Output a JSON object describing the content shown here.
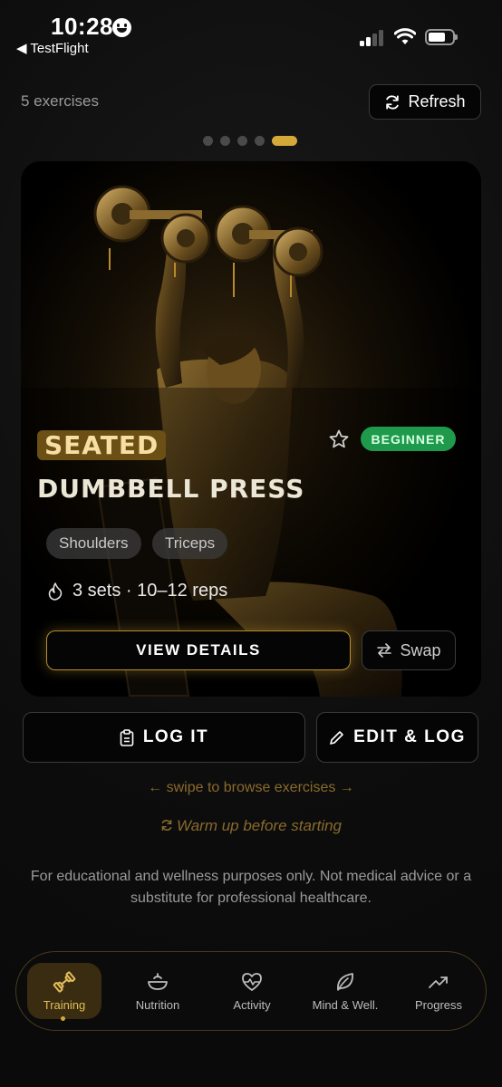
{
  "status_bar": {
    "time": "10:28",
    "back_label": "◀ TestFlight"
  },
  "header": {
    "exercise_count": "5 exercises",
    "refresh_label": "Refresh"
  },
  "pager": {
    "total": 5,
    "active_index": 4
  },
  "card": {
    "title_highlight": "SEATED",
    "title_rest": "DUMBBELL PRESS",
    "favorite_icon": "star-outline-icon",
    "level_badge": "BEGINNER",
    "muscle_tags": [
      "Shoulders",
      "Triceps"
    ],
    "prescription": "3 sets · 10–12 reps",
    "view_details_label": "VIEW DETAILS",
    "swap_label": "Swap"
  },
  "actions": {
    "log_label": "LOG IT",
    "edit_log_label": "EDIT & LOG"
  },
  "hints": {
    "swipe": "← swipe to browse exercises →",
    "warmup": "Warm up before starting"
  },
  "disclaimer": "For educational and wellness purposes only. Not medical advice or a substitute for professional healthcare.",
  "nav": {
    "items": [
      {
        "label": "Training",
        "icon": "dumbbell-icon",
        "active": true
      },
      {
        "label": "Nutrition",
        "icon": "bowl-icon",
        "active": false
      },
      {
        "label": "Activity",
        "icon": "heart-pulse-icon",
        "active": false
      },
      {
        "label": "Mind & Well.",
        "icon": "leaf-icon",
        "active": false
      },
      {
        "label": "Progress",
        "icon": "trend-up-icon",
        "active": false
      }
    ]
  },
  "colors": {
    "accent_gold": "#d4a93a",
    "badge_green": "#1f9a4c",
    "background": "#0d0d0d"
  }
}
